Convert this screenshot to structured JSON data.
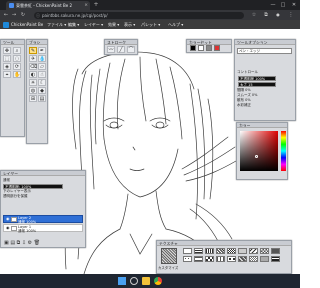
{
  "browser": {
    "tab_title": "東雲茶紅・ChickenPaint Be 2",
    "url": "paintbbs.sakura.ne.jp/cgi/post/p/",
    "new_tab": "+",
    "minimize": "—",
    "maximize": "□",
    "close": "✕"
  },
  "app": {
    "title": "ChickenPaint Be",
    "menus": [
      "ファイル ▾",
      "編集 ▾",
      "レイヤー ▾",
      "効果 ▾",
      "表示 ▾",
      "パレット ▾",
      "ヘルプ ▾"
    ]
  },
  "panels": {
    "tools_title": "ツール",
    "brushes_title": "ブラシ",
    "stroke_title": "ストローク",
    "swatches_title": "カラーセット",
    "options_title": "ツールオプション",
    "options_tab": "ペン・エッジ",
    "options_items": [
      "コントロール",
      "不透明度 100%",
      "太さ 15",
      "間隔 0%",
      "スムーズ 0%",
      "散布 0%",
      "水彩補正"
    ],
    "color_title": "カラー",
    "layers_title": "レイヤー",
    "blend_label": "通常",
    "opacity_label": "不透明度: 100%",
    "clip_label": "下のレイヤー表示",
    "alpha_label": "透明部分を保護",
    "layers": [
      {
        "name": "Layer 2",
        "sub": "通常 100%"
      },
      {
        "name": "Layer 1",
        "sub": "通常 100%"
      }
    ],
    "texture_title": "テクスチャ",
    "texture_caption": "カスタマイズ"
  },
  "colors": {
    "chrome_dark": "#202124",
    "chrome_mid": "#35363a",
    "menu_bg": "#3b3b3b",
    "panel_bg": "#d8dade",
    "selection": "#2f6fd6",
    "sketch": "#333333"
  }
}
